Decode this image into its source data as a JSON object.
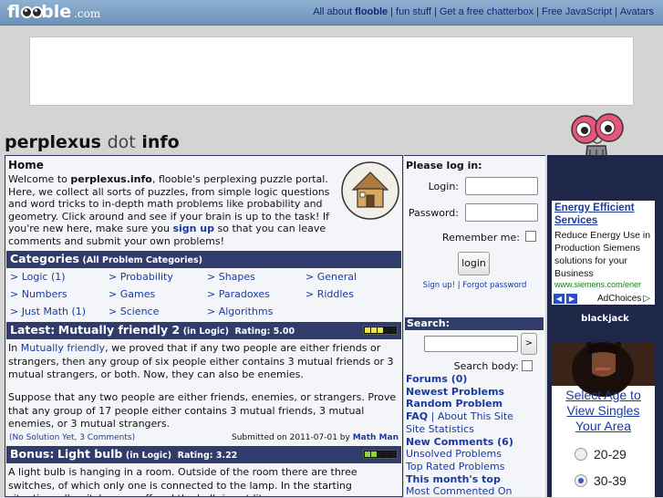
{
  "topbar": {
    "logo_left": "fl",
    "logo_right": "ble",
    "logo_com": ".com",
    "nav": {
      "about_prefix": "All about ",
      "about_bold": "flooble",
      "fun_stuff": "fun stuff",
      "chatterbox": "Get a free chatterbox",
      "javascript": "Free JavaScript",
      "avatars": "Avatars",
      "separator": "|"
    }
  },
  "site_title": {
    "main": "perplexus",
    "dot": "dot",
    "info": "info"
  },
  "home": {
    "title": "Home",
    "intro_1": "Welcome to ",
    "intro_site": "perplexus.info",
    "intro_2": ", flooble's perplexing puzzle portal. Here, we collect all sorts of puzzles, from simple logic questions and word tricks to in-depth math problems like probability and geometry. Click around and see if your brain is up to the task! If you're new here, make sure you ",
    "intro_signup": "sign up",
    "intro_3": " so that you can leave comments and submit your own problems!"
  },
  "categories": {
    "title": "Categories",
    "subtitle": "(All Problem Categories)",
    "items": [
      {
        "label": "> Logic (1)"
      },
      {
        "label": "> Probability"
      },
      {
        "label": "> Shapes"
      },
      {
        "label": "> General"
      },
      {
        "label": "> Numbers"
      },
      {
        "label": "> Games"
      },
      {
        "label": "> Paradoxes"
      },
      {
        "label": "> Riddles"
      },
      {
        "label": "> Just Math (1)"
      },
      {
        "label": "> Science"
      },
      {
        "label": "> Algorithms"
      }
    ]
  },
  "latest": {
    "prefix": "Latest:",
    "title": "Mutually friendly 2",
    "category": "(in Logic)",
    "rating": "Rating: 5.00",
    "rating_level": 0.6,
    "text_1": "In ",
    "link": "Mutually friendly",
    "text_2": ", we proved that if any two people are either friends or strangers, then any group of six people either contains 3 mutual friends or 3 mutual strangers, or both. Now, they can also be enemies.",
    "text_3": "Suppose that any two people are either friends, enemies, or strangers. Prove that any group of 17 people either contains 3 mutual friends, 3 mutual enemies, or 3 mutual strangers.",
    "meta_left": "(No Solution Yet, 3 Comments)",
    "meta_right_prefix": "Submitted on 2011-07-01 by ",
    "author": "Math Man"
  },
  "bonus": {
    "prefix": "Bonus:",
    "title": "Light bulb",
    "category": "(in Logic)",
    "rating": "Rating: 3.22",
    "rating_level": 0.4,
    "text": "A light bulb is hanging in a room. Outside of the room there are three switches, of which only one is connected to the lamp. In the starting situation, all switches are off and the bulb is not lit."
  },
  "login": {
    "title": "Please log in:",
    "login_label": "Login:",
    "password_label": "Password:",
    "remember_label": "Remember me:",
    "button": "login",
    "signup": "Sign up!",
    "forgot": "Forgot password",
    "sep": "|"
  },
  "search": {
    "title": "Search:",
    "button": ">",
    "body_label": "Search body:"
  },
  "side_links": {
    "forums": "Forums (0)",
    "newest": "Newest Problems",
    "random": "Random Problem",
    "faq": "FAQ",
    "about": "About This Site",
    "stats": "Site Statistics",
    "new_comments": "New Comments (6)",
    "unsolved": "Unsolved Problems",
    "top_rated": "Top Rated Problems",
    "month_top": "This month's top",
    "most_commented": "Most Commented On"
  },
  "ads": {
    "ad1_title": "Energy Efficient Services",
    "ad1_body": "Reduce Energy Use in Production Siemens solutions for your Business",
    "ad1_url": "www.siemens.com/ener",
    "adchoices": "AdChoices",
    "blackjack": "blackjack",
    "ad2_headline": "Select Age to View Singles Your Area",
    "ad2_options": [
      "20-29",
      "30-39"
    ],
    "ad2_selected": "30-39"
  },
  "colors": {
    "topbar": "#7a9cc4",
    "header_bar": "#303d6c",
    "link": "#1a3aa0",
    "panel": "#f4f5f9",
    "right_column": "#1e2748"
  }
}
